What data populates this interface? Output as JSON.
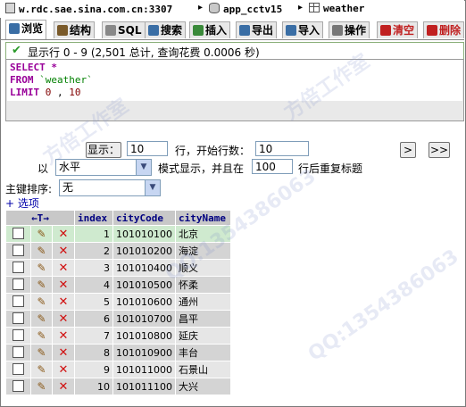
{
  "breadcrumb": {
    "server": "w.rdc.sae.sina.com.cn:3307",
    "database": "app_cctv15",
    "table": "weather"
  },
  "tabs": [
    {
      "label": "浏览",
      "icon": "browse-icon",
      "color": "#3a6ea5"
    },
    {
      "label": "结构",
      "icon": "structure-icon",
      "color": "#7a5a2a"
    },
    {
      "label": "SQL",
      "icon": "sql-icon",
      "color": "#555555"
    },
    {
      "label": "搜索",
      "icon": "search-icon",
      "color": "#3a6ea5"
    },
    {
      "label": "插入",
      "icon": "insert-icon",
      "color": "#3a6ea5"
    },
    {
      "label": "导出",
      "icon": "export-icon",
      "color": "#3a6ea5"
    },
    {
      "label": "导入",
      "icon": "import-icon",
      "color": "#3a6ea5"
    },
    {
      "label": "操作",
      "icon": "operations-icon",
      "color": "#666666"
    },
    {
      "label": "清空",
      "icon": "empty-icon",
      "color": "#c02020"
    },
    {
      "label": "删除",
      "icon": "drop-icon",
      "color": "#c02020"
    }
  ],
  "notice": "显示行 0 - 9 (2,501 总计, 查询花费 0.0006 秒)",
  "sql": {
    "select_kw": "SELECT",
    "select_rest": "*",
    "from_kw": "FROM",
    "from_table": "`weather`",
    "limit_kw": "LIMIT",
    "limit_a": "0",
    "limit_sep": ",",
    "limit_b": "10"
  },
  "nav": {
    "show_button": "显示：",
    "rows_value": "10",
    "start_label": "行，开始行数：",
    "start_value": "10",
    "next_button": ">",
    "last_button": ">>",
    "mode_prefix": "以",
    "mode_value": "水平",
    "mode_suffix": "模式显示，并且在",
    "repeat_value": "100",
    "repeat_suffix": "行后重复标题",
    "sort_label": "主键排序:",
    "sort_value": "无",
    "options_link": "+ 选项"
  },
  "table": {
    "arrows": "←T→",
    "columns": [
      "index",
      "cityCode",
      "cityName"
    ],
    "rows": [
      {
        "index": "1",
        "cityCode": "101010100",
        "cityName": "北京"
      },
      {
        "index": "2",
        "cityCode": "101010200",
        "cityName": "海淀"
      },
      {
        "index": "3",
        "cityCode": "101010400",
        "cityName": "顺义"
      },
      {
        "index": "4",
        "cityCode": "101010500",
        "cityName": "怀柔"
      },
      {
        "index": "5",
        "cityCode": "101010600",
        "cityName": "通州"
      },
      {
        "index": "6",
        "cityCode": "101010700",
        "cityName": "昌平"
      },
      {
        "index": "7",
        "cityCode": "101010800",
        "cityName": "延庆"
      },
      {
        "index": "8",
        "cityCode": "101010900",
        "cityName": "丰台"
      },
      {
        "index": "9",
        "cityCode": "101011000",
        "cityName": "石景山"
      },
      {
        "index": "10",
        "cityCode": "101011100",
        "cityName": "大兴"
      }
    ]
  },
  "watermark": [
    "方倍工作室",
    "QQ:1354386063"
  ]
}
